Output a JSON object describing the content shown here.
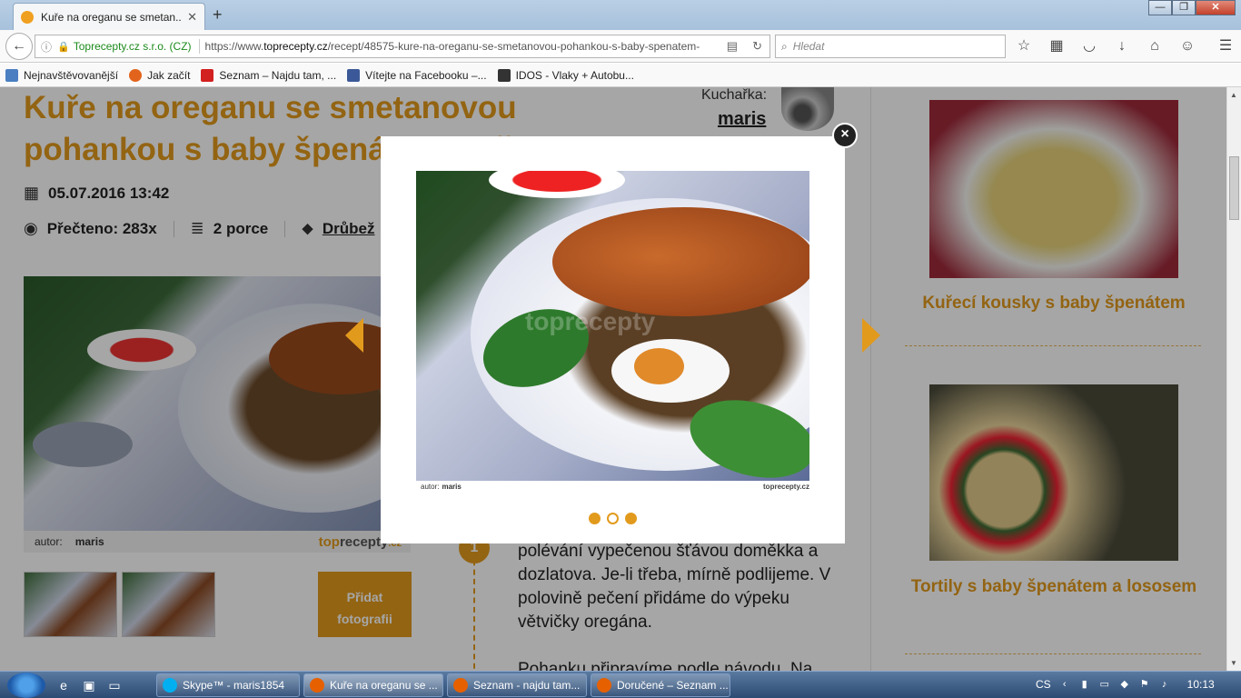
{
  "browser": {
    "tab_title": "Kuře na oreganu se smetan...",
    "tab_close": "✕",
    "newtab": "+",
    "win_controls": [
      "—",
      "❐",
      "✕"
    ],
    "url_org": "Toprecepty.cz s.r.o. (CZ)",
    "url_prefix": "https://www.",
    "url_domain": "toprecepty.cz",
    "url_path": "/recept/48575-kure-na-oreganu-se-smetanovou-pohankou-s-baby-spenatem-",
    "search_placeholder": "Hledat",
    "bookmarks": [
      {
        "label": "Nejnavštěvovanější",
        "color": "#4a7fc1"
      },
      {
        "label": "Jak začít",
        "color": "#e2641c"
      },
      {
        "label": "Seznam – Najdu tam, ...",
        "color": "#d21f1f"
      },
      {
        "label": "Vítejte na Facebooku –...",
        "color": "#3b5998"
      },
      {
        "label": "IDOS - Vlaky + Autobu...",
        "color": "#333333"
      }
    ]
  },
  "recipe": {
    "title": "Kuře na oreganu se smetanovou pohankou s baby špenátem a liškami",
    "author_label": "Kuchařka:",
    "author_name": "maris",
    "date": "05.07.2016 13:42",
    "read_label": "Přečteno: 283x",
    "portions": "2 porce",
    "category": "Drůbež",
    "photo_author_label": "autor:",
    "photo_author": "maris",
    "watermark_a": "top",
    "watermark_b": "recepty",
    "watermark_c": ".cz",
    "add_photo": "Přidat fotografii",
    "step_number": "1",
    "step_text_1": "polévání vypečenou šťávou doměkka a dozlatova. Je-li třeba, mírně podlijeme. V polovině pečení přidáme do výpeku větvičky oregána.",
    "step_text_2": "Pohanku připravíme podle návodu. Na"
  },
  "sidebar": {
    "cards": [
      {
        "title": "Kuřecí kousky s baby špenátem"
      },
      {
        "title": "Tortily s baby špenátem a lososem"
      }
    ]
  },
  "modal": {
    "caption_label": "autor:",
    "caption_author": "maris",
    "watermark_a": "top",
    "watermark_b": "recepty",
    "watermark_c": ".cz",
    "photo_watermark": "toprecepty",
    "close": "×",
    "active_dot": 1,
    "dot_count": 3
  },
  "taskbar": {
    "tasks": [
      {
        "label": "Skype™ - maris1854",
        "color": "#00aff0"
      },
      {
        "label": "Kuře na oreganu se ...",
        "color": "#e66000"
      },
      {
        "label": "Seznam - najdu tam...",
        "color": "#e66000"
      },
      {
        "label": "Doručené – Seznam ...",
        "color": "#e66000"
      }
    ],
    "lang": "CS",
    "time": "10:13"
  }
}
